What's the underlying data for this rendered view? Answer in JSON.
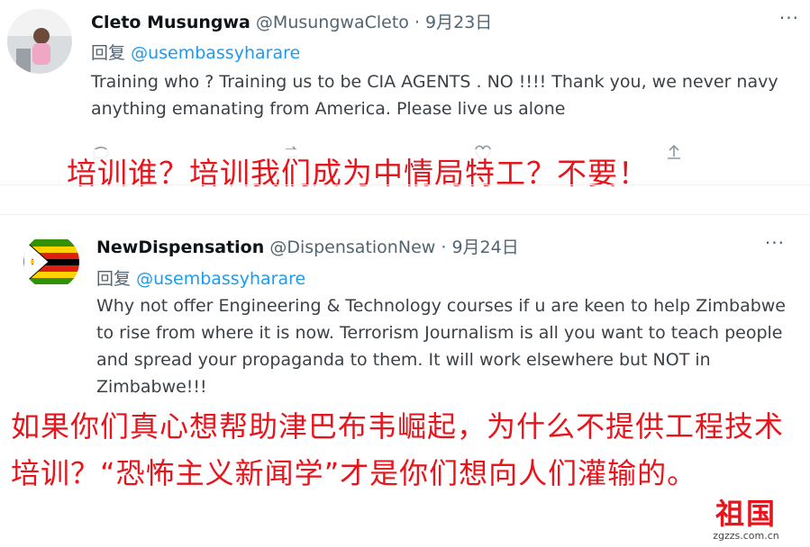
{
  "tweets": [
    {
      "name": "Cleto Musungwa",
      "handle": "@MusungwaCleto",
      "dot": "·",
      "date": "9月23日",
      "reply_prefix": "回复",
      "reply_to": "@usembassyharare",
      "text": "Training who ? Training us to be CIA AGENTS . NO !!!! Thank you, we never navy anything emanating from America. Please live us alone",
      "more": "···",
      "caption": "培训谁？培训我们成为中情局特工？不要！"
    },
    {
      "name": "NewDispensation",
      "handle": "@DispensationNew",
      "dot": "·",
      "date": "9月24日",
      "reply_prefix": "回复",
      "reply_to": "@usembassyharare",
      "text": "Why not offer Engineering & Technology courses if u are keen to help Zimbabwe to rise from where it is now. Terrorism Journalism is all you want to teach people and spread your propaganda to them. It will work elsewhere but NOT in Zimbabwe!!!",
      "more": "···",
      "caption": "如果你们真心想帮助津巴布韦崛起，为什么不提供工程技术培训？“恐怖主义新闻学”才是你们想向人们灌输的。"
    }
  ],
  "watermark": {
    "text": "祖国",
    "site": "zgzzs.com.cn"
  },
  "colors": {
    "caption": "#e8141c",
    "link": "#1d9bf0",
    "muted": "#536471"
  },
  "icons": [
    "comment-icon",
    "retweet-icon",
    "like-icon",
    "share-icon",
    "more-icon"
  ]
}
